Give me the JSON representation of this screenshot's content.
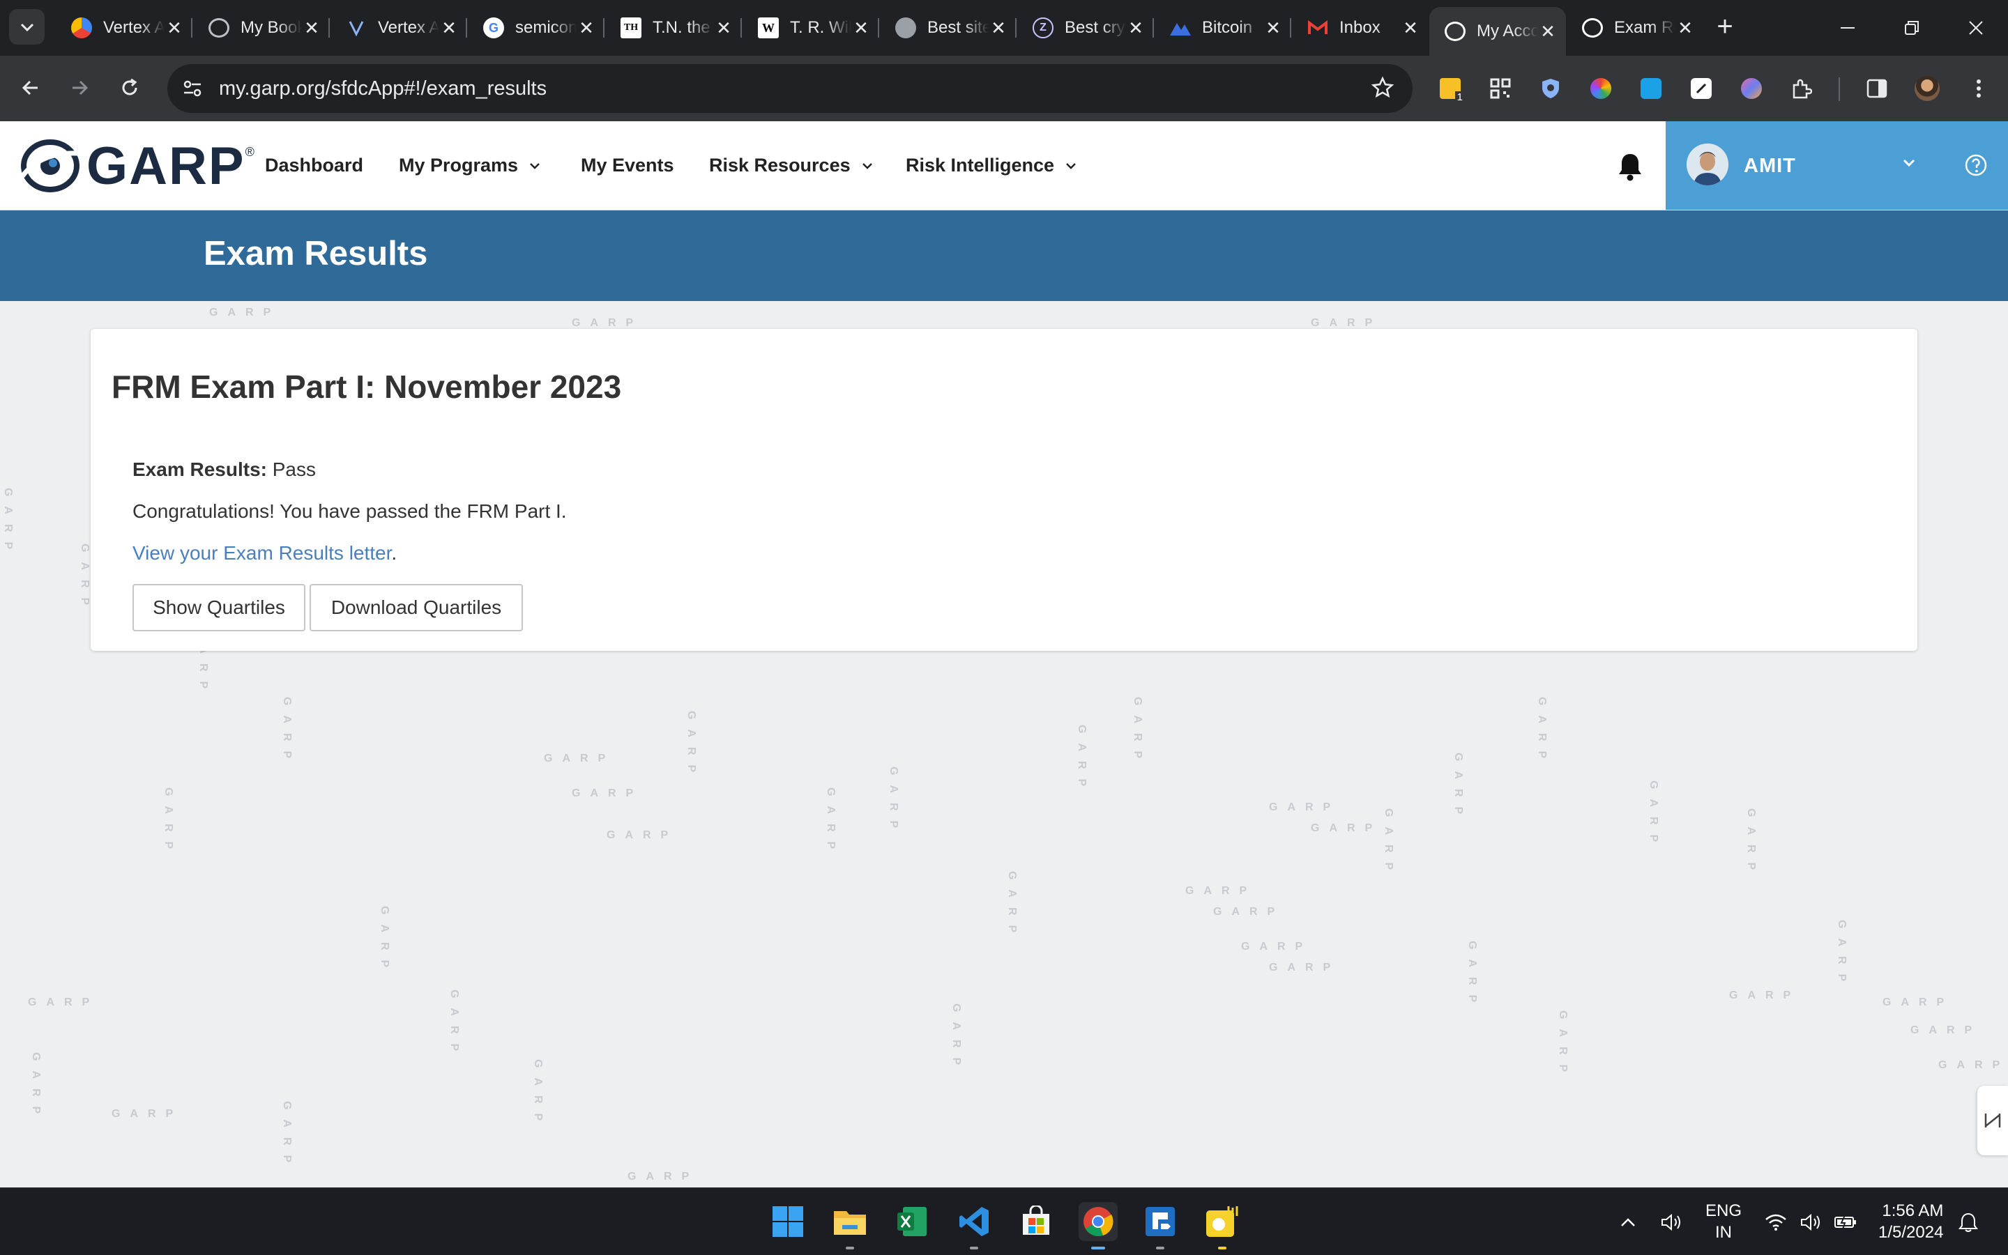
{
  "browser": {
    "tabs": [
      {
        "label": "Vertex AI",
        "icon": "google-cloud-icon",
        "active": false
      },
      {
        "label": "My Bookmarks",
        "icon": "settings-icon",
        "active": false
      },
      {
        "label": "Vertex AI",
        "icon": "vertex-icon",
        "active": false
      },
      {
        "label": "semiconductor",
        "icon": "google-icon",
        "active": false
      },
      {
        "label": "T.N. the Hindu",
        "icon": "the-hindu-icon",
        "active": false
      },
      {
        "label": "T. R. Wikipedia",
        "icon": "wikipedia-icon",
        "active": false
      },
      {
        "label": "Best sites",
        "icon": "globe-icon",
        "active": false
      },
      {
        "label": "Best crypto",
        "icon": "zeta-icon",
        "active": false
      },
      {
        "label": "Bitcoin",
        "icon": "mountain-icon",
        "active": false
      },
      {
        "label": "Inbox",
        "icon": "gmail-icon",
        "active": false
      },
      {
        "label": "My Account",
        "icon": "garp-icon",
        "active": true
      },
      {
        "label": "Exam Results",
        "icon": "garp-icon",
        "active": false
      }
    ],
    "url": "my.garp.org/sfdcApp#!/exam_results",
    "extension_badge": "1"
  },
  "site": {
    "logo_text": "GARP",
    "logo_reg": "®",
    "nav": {
      "dashboard": "Dashboard",
      "programs": "My Programs",
      "events": "My Events",
      "resources": "Risk Resources",
      "intelligence": "Risk Intelligence"
    },
    "user_name": "AMIT",
    "page_title": "Exam Results",
    "watermark": "GARP"
  },
  "card": {
    "title": "FRM Exam Part I: November 2023",
    "result_label": "Exam Results:",
    "result_value": "Pass",
    "message": "Congratulations! You have passed the FRM Part I.",
    "link_text": "View your Exam Results letter",
    "link_suffix": ".",
    "show_quartiles": "Show Quartiles",
    "download_quartiles": "Download Quartiles"
  },
  "taskbar": {
    "apps": [
      "windows-start-icon",
      "file-explorer-icon",
      "excel-icon",
      "vscode-icon",
      "ms-store-icon",
      "chrome-icon",
      "remote-desktop-icon",
      "sticky-player-icon"
    ],
    "lang_line1": "ENG",
    "lang_line2": "IN",
    "time": "1:56 AM",
    "date": "1/5/2024"
  },
  "colors": {
    "title_band": "#2f6a98",
    "user_panel": "#4b9fd5",
    "link": "#4a7fbf",
    "page_bg": "#eeeff1"
  }
}
